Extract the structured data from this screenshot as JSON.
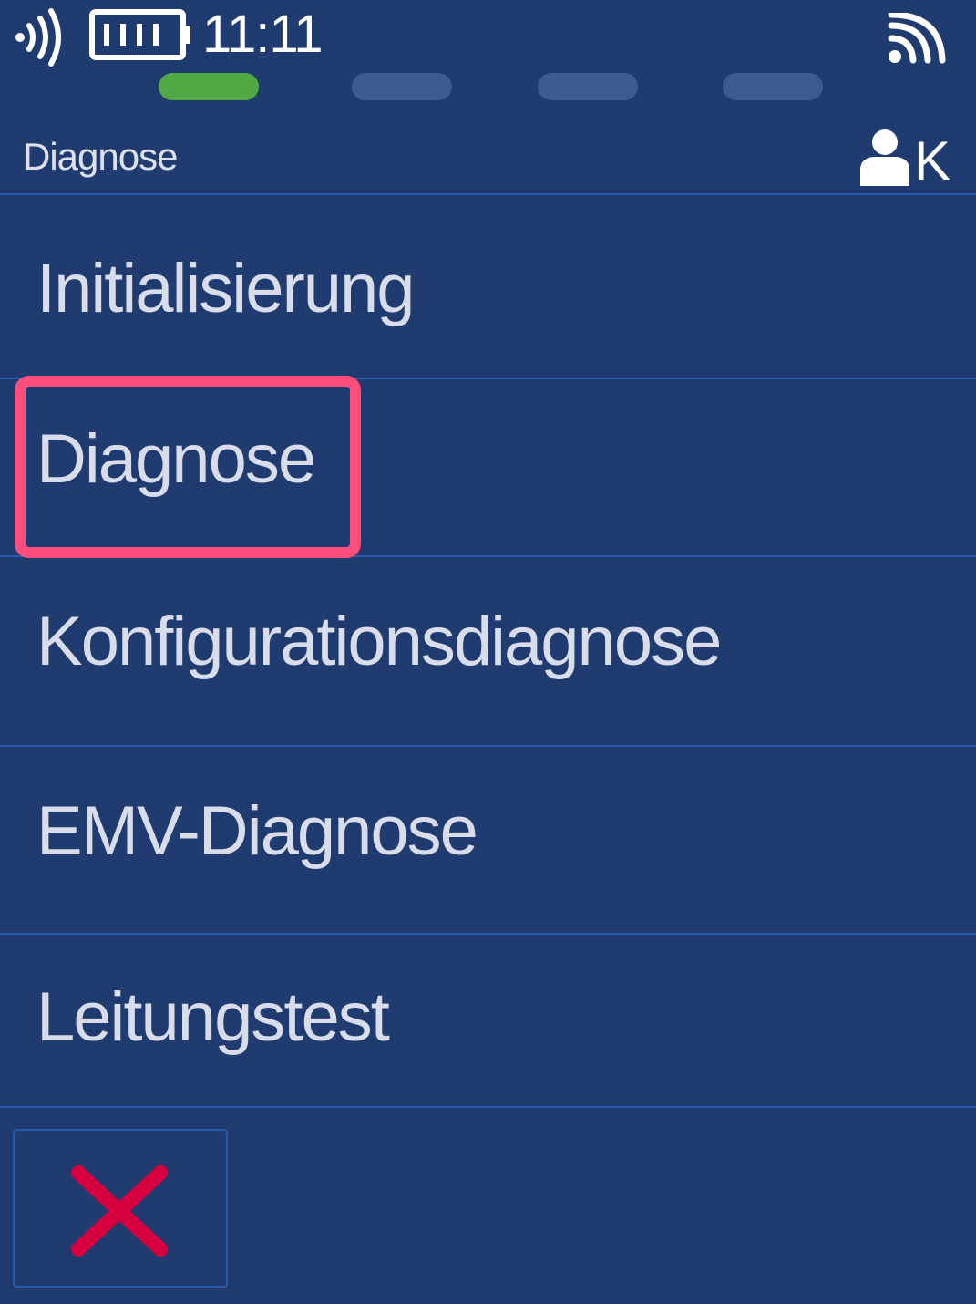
{
  "status": {
    "time": "11:11",
    "icons": [
      "nfc-icon",
      "battery-icon",
      "wifi-icon"
    ]
  },
  "progress": {
    "steps": 4,
    "active_step": 1,
    "active_color": "#52a845",
    "inactive_color": "#3e5a8e"
  },
  "header": {
    "title": "Diagnose",
    "user_icon": "user-icon",
    "user_badge": "K"
  },
  "menu": {
    "items": [
      {
        "label": "Initialisierung"
      },
      {
        "label": "Diagnose"
      },
      {
        "label": "Konfigurationsdiagnose"
      },
      {
        "label": "EMV-Diagnose"
      },
      {
        "label": "Leitungstest"
      }
    ],
    "highlighted_item": "Diagnose",
    "highlight_color": "#ff4d7e"
  },
  "footer": {
    "cancel_icon": "close-icon",
    "cancel_color": "#d6003f"
  },
  "colors": {
    "background": "#1f3b6f",
    "divider": "#2a5aa8",
    "text": "#d9dcea"
  }
}
